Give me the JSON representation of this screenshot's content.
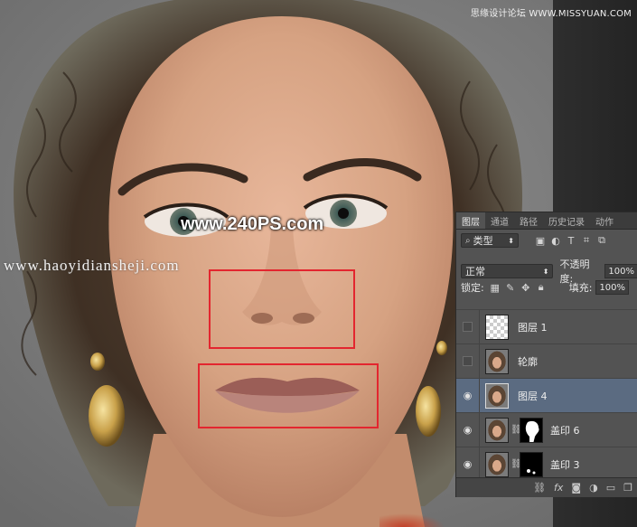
{
  "watermarks": {
    "top_right": "思缘设计论坛 WWW.MISSYUAN.COM",
    "center": "www.240PS.com",
    "left": "www.haoyidiansheji.com"
  },
  "annotations": {
    "box_color": "#e3262f",
    "boxes": [
      "nose-highlight-box",
      "mouth-highlight-box"
    ]
  },
  "layers_panel": {
    "tabs": [
      "图层",
      "通道",
      "路径",
      "历史记录",
      "动作"
    ],
    "active_tab": "图层",
    "filter": {
      "label": "类型",
      "icons": [
        "image-filter-icon",
        "adjustment-filter-icon",
        "type-filter-icon",
        "shape-filter-icon",
        "smartobject-filter-icon"
      ]
    },
    "blend_mode": "正常",
    "opacity_label": "不透明度:",
    "opacity_value": "100%",
    "lock_label": "锁定:",
    "fill_label": "填充:",
    "fill_value": "100%",
    "layers": [
      {
        "name": "图层 1",
        "visible": false,
        "thumb": "transparent"
      },
      {
        "name": "轮廓",
        "visible": false,
        "thumb": "face"
      },
      {
        "name": "图层 4",
        "visible": true,
        "thumb": "face",
        "selected": true
      },
      {
        "name": "盖印 6",
        "visible": true,
        "thumb": "face",
        "mask": true
      },
      {
        "name": "盖印 3",
        "visible": true,
        "thumb": "face",
        "mask": true
      }
    ],
    "selected_color": "#5b6b81",
    "footer_icons": [
      "link-layers-icon",
      "fx-icon",
      "add-mask-icon",
      "adjustment-layer-icon",
      "new-group-icon",
      "new-layer-icon"
    ]
  }
}
